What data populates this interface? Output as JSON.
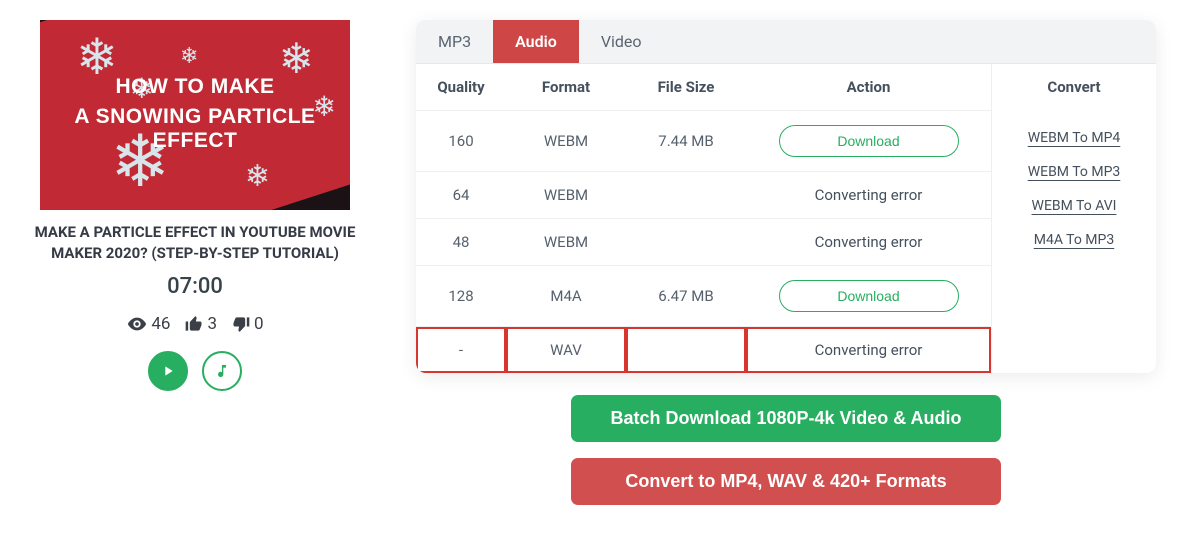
{
  "thumbnail": {
    "line1": "HOW TO MAKE",
    "line2": "A SNOWING PARTICLE EFFECT"
  },
  "video": {
    "title": "MAKE A PARTICLE EFFECT IN YOUTUBE MOVIE MAKER 2020? (STEP-BY-STEP TUTORIAL)",
    "duration": "07:00"
  },
  "stats": {
    "views": "46",
    "likes": "3",
    "dislikes": "0"
  },
  "tabs": {
    "mp3": "MP3",
    "audio": "Audio",
    "video": "Video"
  },
  "headers": {
    "quality": "Quality",
    "format": "Format",
    "size": "File Size",
    "action": "Action",
    "convert": "Convert"
  },
  "rows": [
    {
      "quality": "160",
      "format": "WEBM",
      "size": "7.44 MB",
      "action": "download"
    },
    {
      "quality": "64",
      "format": "WEBM",
      "size": "",
      "action": "error"
    },
    {
      "quality": "48",
      "format": "WEBM",
      "size": "",
      "action": "error"
    },
    {
      "quality": "128",
      "format": "M4A",
      "size": "6.47 MB",
      "action": "download"
    },
    {
      "quality": "-",
      "format": "WAV",
      "size": "",
      "action": "error",
      "highlight": true
    }
  ],
  "labels": {
    "download": "Download",
    "error": "Converting error"
  },
  "convert_links": [
    "WEBM To MP4",
    "WEBM To MP3",
    "WEBM To AVI",
    "M4A To MP3"
  ],
  "buttons": {
    "batch": "Batch Download 1080P-4k Video & Audio",
    "convert": "Convert to MP4, WAV & 420+ Formats"
  }
}
